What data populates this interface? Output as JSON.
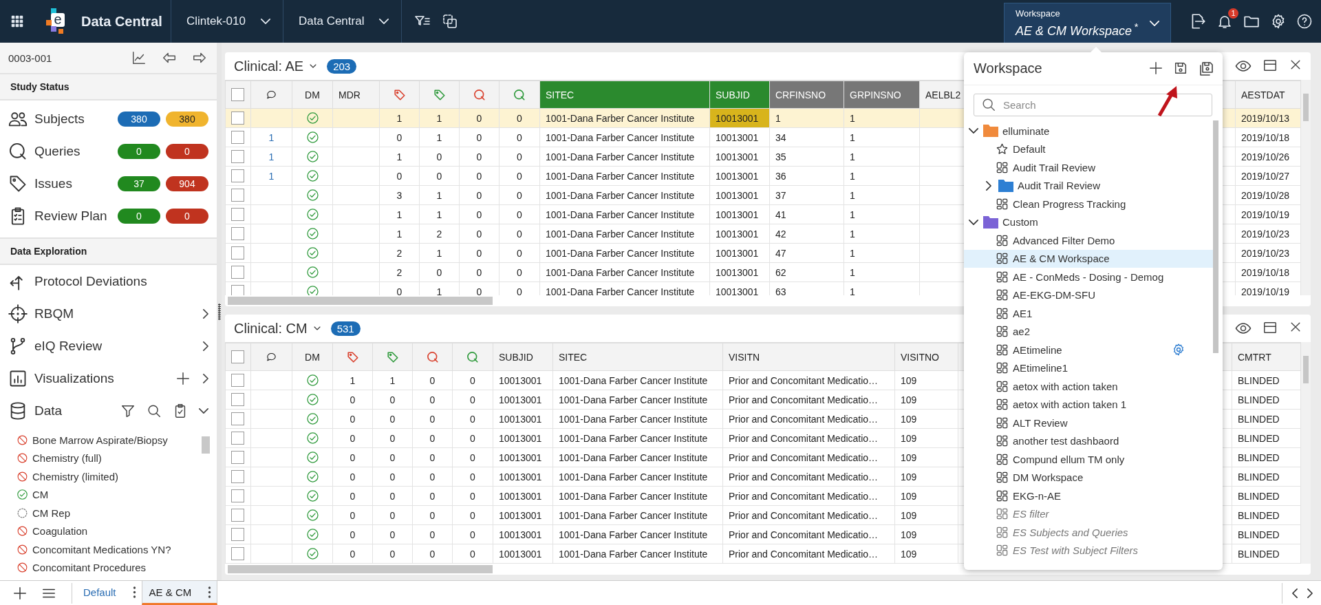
{
  "top_bar": {
    "logo_letter": "e",
    "app_title": "Data Central",
    "dropdowns": [
      "Clintek-010",
      "Data Central"
    ],
    "workspace": {
      "label": "Workspace",
      "name": "AE & CM Workspace",
      "modified_mark": "*"
    },
    "notification_count": "1"
  },
  "sidebar": {
    "subject_id": "0003-001",
    "study_status": {
      "title": "Study Status",
      "items": [
        {
          "label": "Subjects",
          "kind": "subjects",
          "badges": [
            {
              "text": "380",
              "color": "#1c6cb5"
            },
            {
              "text": "380",
              "color": "#f0b42e"
            }
          ]
        },
        {
          "label": "Queries",
          "kind": "queries",
          "badges": [
            {
              "text": "0",
              "color": "#21891f"
            },
            {
              "text": "0",
              "color": "#c0331f"
            }
          ]
        },
        {
          "label": "Issues",
          "kind": "issues",
          "badges": [
            {
              "text": "37",
              "color": "#21891f"
            },
            {
              "text": "904",
              "color": "#c0331f"
            }
          ]
        },
        {
          "label": "Review Plan",
          "kind": "review_plan",
          "badges": [
            {
              "text": "0",
              "color": "#21891f"
            },
            {
              "text": "0",
              "color": "#c0331f"
            }
          ]
        }
      ]
    },
    "data_exploration": {
      "title": "Data Exploration",
      "items": [
        {
          "label": "Protocol Deviations",
          "kind": "deviations"
        },
        {
          "label": "RBQM",
          "kind": "rbqm",
          "expanded": false
        },
        {
          "label": "eIQ Review",
          "kind": "review",
          "expanded": false
        },
        {
          "label": "Visualizations",
          "kind": "visualizations",
          "expanded": false
        },
        {
          "label": "Data",
          "kind": "data",
          "expanded": true
        }
      ]
    },
    "data_sets": [
      {
        "label": "Bone Marrow Aspirate/Biopsy",
        "kind": "unavailable"
      },
      {
        "label": "Chemistry (full)",
        "kind": "unavailable"
      },
      {
        "label": "Chemistry (limited)",
        "kind": "unavailable"
      },
      {
        "label": "CM",
        "kind": "available"
      },
      {
        "label": "CM Rep",
        "kind": "pending"
      },
      {
        "label": "Coagulation",
        "kind": "unavailable"
      },
      {
        "label": "Concomitant Medications YN?",
        "kind": "unavailable"
      },
      {
        "label": "Concomitant Procedures",
        "kind": "unavailable"
      }
    ]
  },
  "panels": [
    {
      "title": "Clinical: AE",
      "count": "203",
      "columns": [
        {
          "kind": "checkbox",
          "checked": false
        },
        {
          "kind": "comments"
        },
        {
          "kind": "dm",
          "label": "DM"
        },
        {
          "kind": "blank",
          "label": "MDR"
        },
        {
          "kind": "tag_count",
          "color": "#d9412e"
        },
        {
          "kind": "tag_count",
          "color": "#2f9a3c"
        },
        {
          "kind": "query_count",
          "color": "#d9412e"
        },
        {
          "kind": "query_count",
          "color": "#2f9a3c"
        },
        {
          "kind": "text",
          "label": "SITEC",
          "color": "#2b8a2e"
        },
        {
          "kind": "text",
          "label": "SUBJID",
          "color": "#2b8a2e"
        },
        {
          "kind": "text",
          "label": "CRFINSNO",
          "color": "#777777"
        },
        {
          "kind": "text",
          "label": "GRPINSNO",
          "color": "#777777"
        },
        {
          "kind": "blank",
          "label": "AELBL2"
        }
      ],
      "right_columns": [
        {
          "label": "AESTDAT"
        }
      ],
      "rows": [
        {
          "selected": true,
          "cells": [
            {
              "checked": false
            },
            "",
            {
              "reviewed": true
            },
            "",
            "1",
            "1",
            "0",
            "0",
            "1001-Dana Farber Cancer Institute",
            {
              "text": "10013001",
              "flagged": true
            },
            "1",
            "1",
            ""
          ],
          "right_cells": [
            "2019/10/13"
          ]
        },
        {
          "selected": false,
          "cells": [
            {
              "checked": false
            },
            "1",
            {
              "reviewed": true
            },
            "",
            "0",
            "1",
            "0",
            "0",
            "1001-Dana Farber Cancer Institute",
            "10013001",
            "34",
            "1",
            ""
          ],
          "right_cells": [
            "2019/10/18"
          ]
        },
        {
          "selected": false,
          "cells": [
            {
              "checked": false
            },
            "1",
            {
              "reviewed": true
            },
            "",
            "1",
            "0",
            "0",
            "0",
            "1001-Dana Farber Cancer Institute",
            "10013001",
            "35",
            "1",
            ""
          ],
          "right_cells": [
            "2019/10/26"
          ]
        },
        {
          "selected": false,
          "cells": [
            {
              "checked": false
            },
            "1",
            {
              "reviewed": true
            },
            "",
            "0",
            "0",
            "0",
            "0",
            "1001-Dana Farber Cancer Institute",
            "10013001",
            "36",
            "1",
            ""
          ],
          "right_cells": [
            "2019/10/27"
          ]
        },
        {
          "selected": false,
          "cells": [
            {
              "checked": false
            },
            "",
            {
              "reviewed": true
            },
            "",
            "3",
            "1",
            "0",
            "0",
            "1001-Dana Farber Cancer Institute",
            "10013001",
            "37",
            "1",
            ""
          ],
          "right_cells": [
            "2019/10/28"
          ]
        },
        {
          "selected": false,
          "cells": [
            {
              "checked": false
            },
            "",
            {
              "reviewed": true
            },
            "",
            "1",
            "1",
            "0",
            "0",
            "1001-Dana Farber Cancer Institute",
            "10013001",
            "41",
            "1",
            ""
          ],
          "right_cells": [
            "2019/10/19"
          ]
        },
        {
          "selected": false,
          "cells": [
            {
              "checked": false
            },
            "",
            {
              "reviewed": true
            },
            "",
            "1",
            "2",
            "0",
            "0",
            "1001-Dana Farber Cancer Institute",
            "10013001",
            "42",
            "1",
            ""
          ],
          "right_cells": [
            "2019/10/23"
          ]
        },
        {
          "selected": false,
          "cells": [
            {
              "checked": false
            },
            "",
            {
              "reviewed": true
            },
            "",
            "2",
            "1",
            "0",
            "0",
            "1001-Dana Farber Cancer Institute",
            "10013001",
            "47",
            "1",
            ""
          ],
          "right_cells": [
            "2019/10/23"
          ]
        },
        {
          "selected": false,
          "cells": [
            {
              "checked": false
            },
            "",
            {
              "reviewed": true
            },
            "",
            "2",
            "0",
            "0",
            "0",
            "1001-Dana Farber Cancer Institute",
            "10013001",
            "62",
            "1",
            ""
          ],
          "right_cells": [
            "2019/10/18"
          ]
        },
        {
          "selected": false,
          "cells": [
            {
              "checked": false
            },
            "",
            {
              "reviewed": true
            },
            "",
            "0",
            "1",
            "0",
            "0",
            "1001-Dana Farber Cancer Institute",
            "10013001",
            "63",
            "1",
            ""
          ],
          "right_cells": [
            "2019/10/19"
          ]
        }
      ]
    },
    {
      "title": "Clinical: CM",
      "count": "531",
      "columns": [
        {
          "kind": "checkbox",
          "checked": false
        },
        {
          "kind": "comments"
        },
        {
          "kind": "dm",
          "label": "DM"
        },
        {
          "kind": "tag_count",
          "color": "#d9412e"
        },
        {
          "kind": "tag_count",
          "color": "#2f9a3c"
        },
        {
          "kind": "query_count",
          "color": "#d9412e"
        },
        {
          "kind": "query_count",
          "color": "#2f9a3c"
        },
        {
          "kind": "text",
          "label": "SUBJID"
        },
        {
          "kind": "text",
          "label": "SITEC"
        },
        {
          "kind": "text",
          "label": "VISITN"
        },
        {
          "kind": "text",
          "label": "VISITNO"
        }
      ],
      "right_columns": [
        {
          "label": "CMTRT"
        }
      ],
      "rows": [
        {
          "selected": false,
          "cells": [
            {
              "checked": false
            },
            "",
            {
              "reviewed": true
            },
            "1",
            "1",
            "0",
            "0",
            "10013001",
            "1001-Dana Farber Cancer Institute",
            "Prior and Concomitant Medicatio…",
            "109"
          ],
          "right_cells": [
            "BLINDED"
          ]
        },
        {
          "selected": false,
          "cells": [
            {
              "checked": false
            },
            "",
            {
              "reviewed": true
            },
            "0",
            "0",
            "0",
            "0",
            "10013001",
            "1001-Dana Farber Cancer Institute",
            "Prior and Concomitant Medicatio…",
            "109"
          ],
          "right_cells": [
            "BLINDED"
          ]
        },
        {
          "selected": false,
          "cells": [
            {
              "checked": false
            },
            "",
            {
              "reviewed": true
            },
            "0",
            "0",
            "0",
            "0",
            "10013001",
            "1001-Dana Farber Cancer Institute",
            "Prior and Concomitant Medicatio…",
            "109"
          ],
          "right_cells": [
            "BLINDED"
          ]
        },
        {
          "selected": false,
          "cells": [
            {
              "checked": false
            },
            "",
            {
              "reviewed": true
            },
            "0",
            "0",
            "0",
            "0",
            "10013001",
            "1001-Dana Farber Cancer Institute",
            "Prior and Concomitant Medicatio…",
            "109"
          ],
          "right_cells": [
            "BLINDED"
          ]
        },
        {
          "selected": false,
          "cells": [
            {
              "checked": false
            },
            "",
            {
              "reviewed": true
            },
            "0",
            "0",
            "0",
            "0",
            "10013001",
            "1001-Dana Farber Cancer Institute",
            "Prior and Concomitant Medicatio…",
            "109"
          ],
          "right_cells": [
            "BLINDED"
          ]
        },
        {
          "selected": false,
          "cells": [
            {
              "checked": false
            },
            "",
            {
              "reviewed": true
            },
            "0",
            "0",
            "0",
            "0",
            "10013001",
            "1001-Dana Farber Cancer Institute",
            "Prior and Concomitant Medicatio…",
            "109"
          ],
          "right_cells": [
            "BLINDED"
          ]
        },
        {
          "selected": false,
          "cells": [
            {
              "checked": false
            },
            "",
            {
              "reviewed": true
            },
            "0",
            "0",
            "0",
            "0",
            "10013001",
            "1001-Dana Farber Cancer Institute",
            "Prior and Concomitant Medicatio…",
            "109"
          ],
          "right_cells": [
            "BLINDED"
          ]
        },
        {
          "selected": false,
          "cells": [
            {
              "checked": false
            },
            "",
            {
              "reviewed": true
            },
            "0",
            "0",
            "0",
            "0",
            "10013001",
            "1001-Dana Farber Cancer Institute",
            "Prior and Concomitant Medicatio…",
            "109"
          ],
          "right_cells": [
            "BLINDED"
          ]
        },
        {
          "selected": false,
          "cells": [
            {
              "checked": false
            },
            "",
            {
              "reviewed": true
            },
            "0",
            "0",
            "0",
            "0",
            "10013001",
            "1001-Dana Farber Cancer Institute",
            "Prior and Concomitant Medicatio…",
            "109"
          ],
          "right_cells": [
            "BLINDED"
          ]
        },
        {
          "selected": false,
          "cells": [
            {
              "checked": false
            },
            "",
            {
              "reviewed": true
            },
            "0",
            "0",
            "0",
            "0",
            "10013001",
            "1001-Dana Farber Cancer Institute",
            "Prior and Concomitant Medicatio…",
            "109"
          ],
          "right_cells": [
            "BLINDED"
          ]
        }
      ]
    }
  ],
  "workspace_panel": {
    "title": "Workspace",
    "search": {
      "placeholder": "Search"
    },
    "tree": [
      {
        "label": "elluminate",
        "kind": "folder",
        "color": "#f08a3c",
        "expanded": true,
        "children": [
          {
            "label": "Default",
            "kind": "default",
            "selected": false,
            "inactive": false,
            "show_settings": false
          },
          {
            "label": "Audit Trail Review",
            "kind": "dashboard",
            "selected": false,
            "inactive": false,
            "show_settings": false
          },
          {
            "label": "Audit Trail Review",
            "kind": "folder",
            "color": "#2d7fd3",
            "expanded": false
          },
          {
            "label": "Clean Progress Tracking",
            "kind": "dashboard",
            "selected": false,
            "inactive": false,
            "show_settings": false
          }
        ]
      },
      {
        "label": "Custom",
        "kind": "folder",
        "color": "#7b63d6",
        "expanded": true,
        "children": [
          {
            "label": "Advanced Filter Demo",
            "kind": "dashboard",
            "selected": false,
            "inactive": false,
            "show_settings": false
          },
          {
            "label": "AE & CM Workspace",
            "kind": "dashboard",
            "selected": true,
            "inactive": false,
            "show_settings": false
          },
          {
            "label": "AE - ConMeds - Dosing - Demog",
            "kind": "dashboard",
            "selected": false,
            "inactive": false,
            "show_settings": false
          },
          {
            "label": "AE-EKG-DM-SFU",
            "kind": "dashboard",
            "selected": false,
            "inactive": false,
            "show_settings": false
          },
          {
            "label": "AE1",
            "kind": "dashboard",
            "selected": false,
            "inactive": false,
            "show_settings": false
          },
          {
            "label": "ae2",
            "kind": "dashboard",
            "selected": false,
            "inactive": false,
            "show_settings": false
          },
          {
            "label": "AEtimeline",
            "kind": "dashboard",
            "selected": false,
            "inactive": false,
            "show_settings": true
          },
          {
            "label": "AEtimeline1",
            "kind": "dashboard",
            "selected": false,
            "inactive": false,
            "show_settings": false
          },
          {
            "label": "aetox with action taken",
            "kind": "dashboard",
            "selected": false,
            "inactive": false,
            "show_settings": false
          },
          {
            "label": "aetox with action taken 1",
            "kind": "dashboard",
            "selected": false,
            "inactive": false,
            "show_settings": false
          },
          {
            "label": "ALT Review",
            "kind": "dashboard",
            "selected": false,
            "inactive": false,
            "show_settings": false
          },
          {
            "label": "another test dashbaord",
            "kind": "dashboard",
            "selected": false,
            "inactive": false,
            "show_settings": false
          },
          {
            "label": "Compund ellum TM only",
            "kind": "dashboard",
            "selected": false,
            "inactive": false,
            "show_settings": false
          },
          {
            "label": "DM Workspace",
            "kind": "dashboard",
            "selected": false,
            "inactive": false,
            "show_settings": false
          },
          {
            "label": "EKG-n-AE",
            "kind": "dashboard",
            "selected": false,
            "inactive": false,
            "show_settings": false
          },
          {
            "label": "ES filter",
            "kind": "dashboard",
            "selected": false,
            "inactive": true,
            "show_settings": false
          },
          {
            "label": "ES Subjects and Queries",
            "kind": "dashboard",
            "selected": false,
            "inactive": true,
            "show_settings": false
          },
          {
            "label": "ES Test with Subject Filters",
            "kind": "dashboard",
            "selected": false,
            "inactive": true,
            "show_settings": false
          }
        ]
      }
    ]
  },
  "bottom_bar": {
    "tabs": [
      {
        "label": "Default",
        "selected": false
      },
      {
        "label": "AE & CM",
        "selected": true
      }
    ]
  }
}
